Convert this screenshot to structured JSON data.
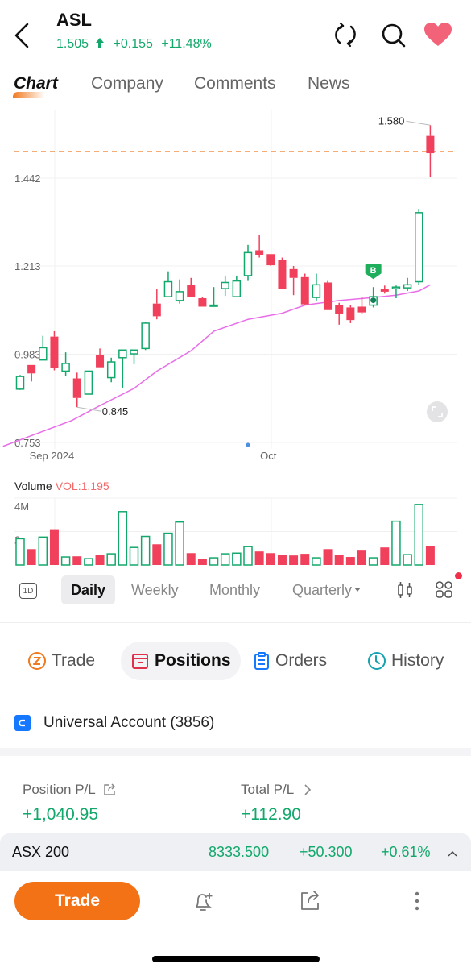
{
  "header": {
    "ticker": "ASL",
    "price": "1.505",
    "change": "+0.155",
    "change_pct": "+11.48%",
    "icons": [
      "back-chevron",
      "refresh-icon",
      "search-icon",
      "heart-icon"
    ],
    "up_color": "#13a86b",
    "favorite_color": "#f2637a"
  },
  "tabs": [
    {
      "label": "Chart",
      "active": true
    },
    {
      "label": "Company",
      "active": false
    },
    {
      "label": "Comments",
      "active": false
    },
    {
      "label": "News",
      "active": false
    }
  ],
  "chart_data": {
    "type": "candlestick",
    "title": "ASL Daily",
    "x_labels": [
      {
        "label": "Sep 2024",
        "index": 3
      },
      {
        "label": "Oct",
        "index": 22
      }
    ],
    "y_ticks": [
      0.753,
      0.983,
      1.213,
      1.442
    ],
    "ylim": [
      0.753,
      1.58
    ],
    "price_line": 1.505,
    "high_annotation": {
      "label": "1.580",
      "index": 36
    },
    "low_annotation": {
      "label": "0.845",
      "index": 5
    },
    "buy_marker": {
      "label": "B",
      "index": 31
    },
    "up_color": "#13a86b",
    "down_color": "#f0405b",
    "ma_color": "#e86de8",
    "candles": [
      {
        "o": 0.892,
        "h": 0.929,
        "l": 0.89,
        "c": 0.925
      },
      {
        "o": 0.955,
        "h": 0.955,
        "l": 0.912,
        "c": 0.933
      },
      {
        "o": 0.968,
        "h": 1.031,
        "l": 0.968,
        "c": 1.0
      },
      {
        "o": 1.029,
        "h": 1.043,
        "l": 0.941,
        "c": 0.947
      },
      {
        "o": 0.939,
        "h": 0.988,
        "l": 0.927,
        "c": 0.959
      },
      {
        "o": 0.92,
        "h": 0.935,
        "l": 0.845,
        "c": 0.869
      },
      {
        "o": 0.879,
        "h": 0.939,
        "l": 0.879,
        "c": 0.939
      },
      {
        "o": 0.98,
        "h": 0.998,
        "l": 0.949,
        "c": 0.949
      },
      {
        "o": 0.922,
        "h": 0.974,
        "l": 0.91,
        "c": 0.963
      },
      {
        "o": 0.974,
        "h": 0.994,
        "l": 0.896,
        "c": 0.994
      },
      {
        "o": 0.984,
        "h": 0.994,
        "l": 0.957,
        "c": 0.994
      },
      {
        "o": 0.998,
        "h": 1.068,
        "l": 0.994,
        "c": 1.064
      },
      {
        "o": 1.115,
        "h": 1.152,
        "l": 1.074,
        "c": 1.082
      },
      {
        "o": 1.133,
        "h": 1.199,
        "l": 1.133,
        "c": 1.172
      },
      {
        "o": 1.123,
        "h": 1.178,
        "l": 1.115,
        "c": 1.146
      },
      {
        "o": 1.164,
        "h": 1.182,
        "l": 1.133,
        "c": 1.133
      },
      {
        "o": 1.129,
        "h": 1.131,
        "l": 1.107,
        "c": 1.107
      },
      {
        "o": 1.109,
        "h": 1.158,
        "l": 1.109,
        "c": 1.111
      },
      {
        "o": 1.154,
        "h": 1.188,
        "l": 1.135,
        "c": 1.17
      },
      {
        "o": 1.133,
        "h": 1.188,
        "l": 1.133,
        "c": 1.174
      },
      {
        "o": 1.188,
        "h": 1.268,
        "l": 1.174,
        "c": 1.248
      },
      {
        "o": 1.254,
        "h": 1.293,
        "l": 1.235,
        "c": 1.242
      },
      {
        "o": 1.244,
        "h": 1.244,
        "l": 1.213,
        "c": 1.215
      },
      {
        "o": 1.229,
        "h": 1.235,
        "l": 1.154,
        "c": 1.154
      },
      {
        "o": 1.205,
        "h": 1.213,
        "l": 1.137,
        "c": 1.182
      },
      {
        "o": 1.184,
        "h": 1.193,
        "l": 1.111,
        "c": 1.113
      },
      {
        "o": 1.131,
        "h": 1.193,
        "l": 1.123,
        "c": 1.164
      },
      {
        "o": 1.17,
        "h": 1.174,
        "l": 1.098,
        "c": 1.098
      },
      {
        "o": 1.111,
        "h": 1.117,
        "l": 1.06,
        "c": 1.088
      },
      {
        "o": 1.105,
        "h": 1.111,
        "l": 1.064,
        "c": 1.072
      },
      {
        "o": 1.107,
        "h": 1.133,
        "l": 1.088,
        "c": 1.092
      },
      {
        "o": 1.111,
        "h": 1.158,
        "l": 1.105,
        "c": 1.133
      },
      {
        "o": 1.154,
        "h": 1.162,
        "l": 1.141,
        "c": 1.146
      },
      {
        "o": 1.154,
        "h": 1.162,
        "l": 1.129,
        "c": 1.158
      },
      {
        "o": 1.156,
        "h": 1.182,
        "l": 1.148,
        "c": 1.164
      },
      {
        "o": 1.172,
        "h": 1.362,
        "l": 1.164,
        "c": 1.352
      },
      {
        "o": 1.552,
        "h": 1.58,
        "l": 1.444,
        "c": 1.507
      }
    ],
    "ma": [
      {
        "i": -1.5,
        "v": 0.743
      },
      {
        "i": 1,
        "v": 0.771
      },
      {
        "i": 4.5,
        "v": 0.81
      },
      {
        "i": 7,
        "v": 0.849
      },
      {
        "i": 10,
        "v": 0.894
      },
      {
        "i": 12,
        "v": 0.939
      },
      {
        "i": 15,
        "v": 0.992
      },
      {
        "i": 17,
        "v": 1.043
      },
      {
        "i": 20,
        "v": 1.074
      },
      {
        "i": 23,
        "v": 1.09
      },
      {
        "i": 25,
        "v": 1.111
      },
      {
        "i": 28,
        "v": 1.123
      },
      {
        "i": 31,
        "v": 1.131
      },
      {
        "i": 33,
        "v": 1.137
      },
      {
        "i": 35,
        "v": 1.148
      },
      {
        "i": 36,
        "v": 1.164
      }
    ],
    "volume": {
      "label": "Volume",
      "indicator": "VOL:1.195",
      "unit": "M",
      "y_ticks": [
        "4M",
        "2"
      ],
      "ylim": [
        0,
        4
      ],
      "values": [
        1.57,
        0.95,
        1.67,
        2.14,
        0.48,
        0.52,
        0.38,
        0.62,
        0.67,
        3.19,
        1.05,
        1.71,
        1.24,
        1.9,
        2.57,
        0.71,
        0.38,
        0.43,
        0.67,
        0.71,
        1.1,
        0.81,
        0.71,
        0.62,
        0.57,
        0.67,
        0.43,
        0.95,
        0.62,
        0.48,
        0.86,
        0.43,
        1.05,
        2.62,
        0.62,
        3.62,
        1.14
      ]
    }
  },
  "periods": {
    "icon": "1D",
    "items": [
      {
        "label": "Daily",
        "active": true
      },
      {
        "label": "Weekly",
        "active": false
      },
      {
        "label": "Monthly",
        "active": false
      },
      {
        "label": "Quarterly",
        "active": false
      }
    ]
  },
  "trade_tabs": [
    {
      "label": "Trade",
      "icon": "trade-icon",
      "color": "#f07a1f",
      "active": false
    },
    {
      "label": "Positions",
      "icon": "positions-icon",
      "color": "#e0304a",
      "active": true
    },
    {
      "label": "Orders",
      "icon": "orders-icon",
      "color": "#1677ff",
      "active": false
    },
    {
      "label": "History",
      "icon": "history-icon",
      "color": "#17a2b0",
      "active": false
    }
  ],
  "account": {
    "name": "Universal Account (3856)"
  },
  "pl": {
    "position_label": "Position P/L",
    "position_value": "+1,040.95",
    "total_label": "Total P/L",
    "total_value": "+112.90"
  },
  "index": {
    "name": "ASX 200",
    "value": "8333.500",
    "change": "+50.300",
    "change_pct": "+0.61%"
  },
  "bottom": {
    "trade_label": "Trade",
    "trade_color": "#f47216"
  }
}
